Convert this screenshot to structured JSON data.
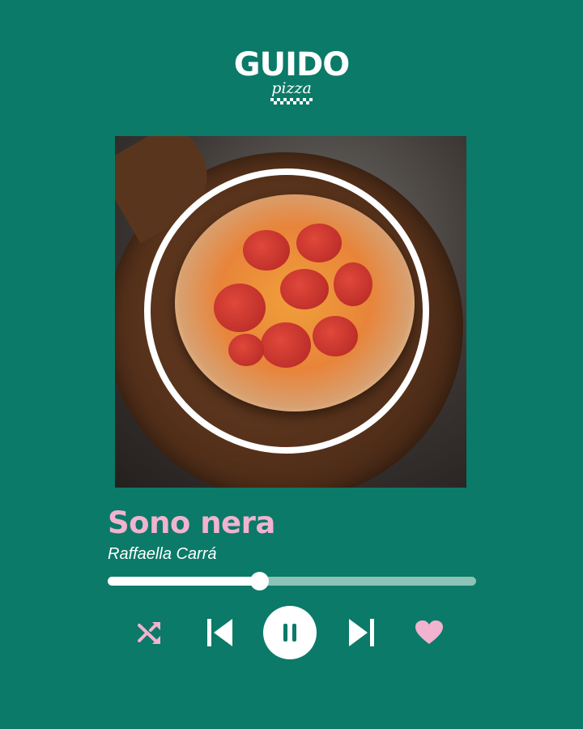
{
  "brand": {
    "name": "GUIDO",
    "sub": "pizza"
  },
  "track": {
    "title": "Sono nera",
    "artist": "Raffaella Carrá"
  },
  "player": {
    "progress": 0.41,
    "controls": [
      "shuffle",
      "previous",
      "pause",
      "next",
      "like"
    ]
  },
  "colors": {
    "background": "#0b7a68",
    "title": "#f1b3cf",
    "accent": "#f1b3cf",
    "track": "#8dc2b7",
    "track_fill": "#ffffff"
  },
  "icons": {
    "shuffle": "shuffle-icon",
    "previous": "skip-previous-icon",
    "pause": "pause-icon",
    "next": "skip-next-icon",
    "like": "heart-icon"
  }
}
